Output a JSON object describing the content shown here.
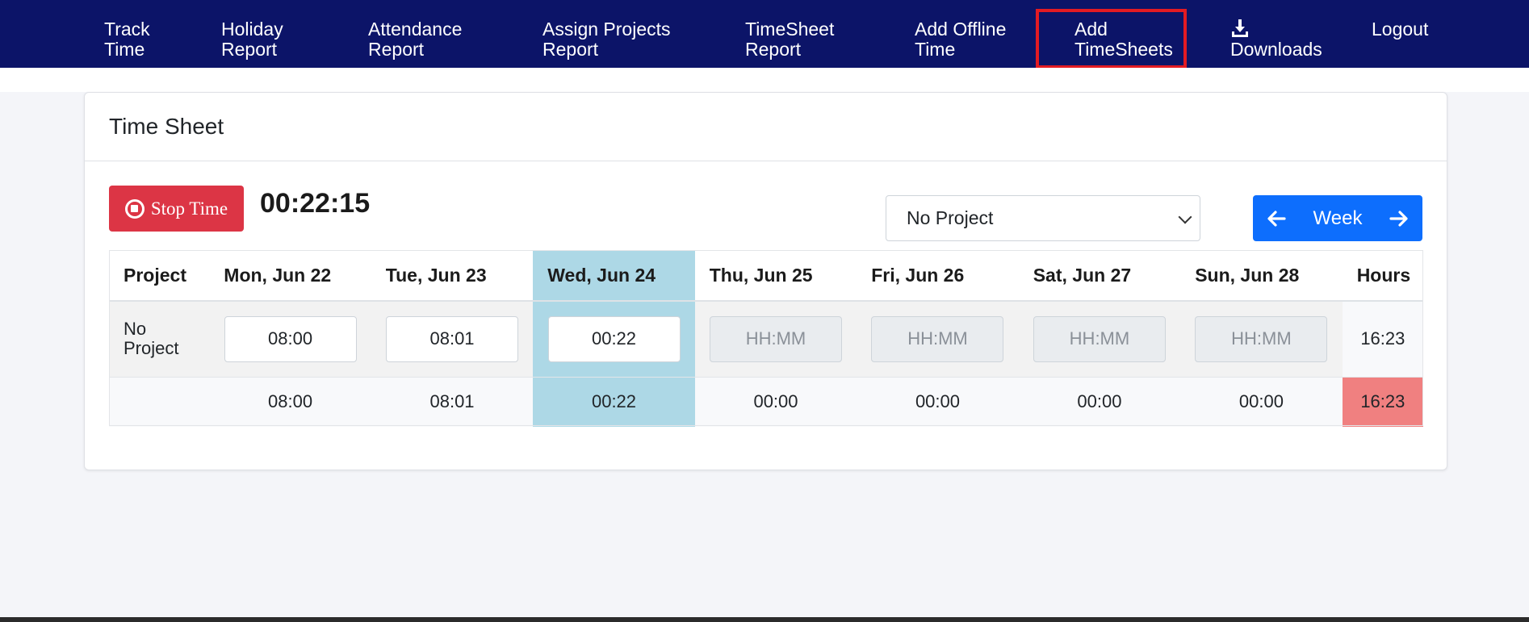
{
  "nav": {
    "track_time": [
      "Track",
      "Time"
    ],
    "holiday_report": [
      "Holiday",
      "Report"
    ],
    "attendance_report": [
      "Attendance",
      "Report"
    ],
    "assign_projects_report": [
      "Assign Projects",
      "Report"
    ],
    "timesheet_report": [
      "TimeSheet",
      "Report"
    ],
    "add_offline_time": [
      "Add Offline",
      "Time"
    ],
    "add_timesheets": [
      "Add",
      "TimeSheets"
    ],
    "downloads": "Downloads",
    "logout": "Logout"
  },
  "card": {
    "title": "Time Sheet",
    "stop_label": "Stop Time",
    "timer": "00:22:15",
    "project_select": "No Project",
    "week_label": "Week"
  },
  "table": {
    "headers": [
      "Project",
      "Mon, Jun 22",
      "Tue, Jun 23",
      "Wed, Jun 24",
      "Thu, Jun 25",
      "Fri, Jun 26",
      "Sat, Jun 27",
      "Sun, Jun 28",
      "Hours"
    ],
    "row_project": [
      "No",
      "Project"
    ],
    "entries": [
      "08:00",
      "08:01",
      "00:22",
      "",
      "",
      "",
      ""
    ],
    "placeholder": "HH:MM",
    "row_hours": "16:23",
    "totals": [
      "08:00",
      "08:01",
      "00:22",
      "00:00",
      "00:00",
      "00:00",
      "00:00"
    ],
    "total_hours": "16:23"
  },
  "colors": {
    "nav_bg": "#0c1468",
    "active_outline": "#e31b23",
    "stop_button": "#dc3545",
    "week_button": "#0d6efd",
    "today_highlight": "#add8e6",
    "total_hours_bg": "#f08080"
  }
}
